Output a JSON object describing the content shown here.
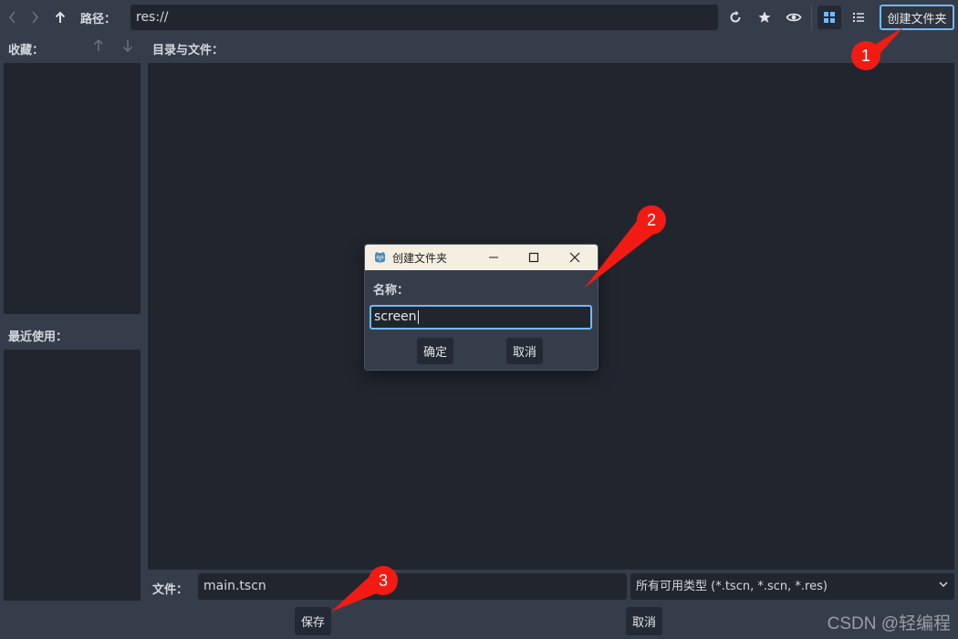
{
  "toolbar": {
    "path_label": "路径：",
    "path_value": "res://",
    "create_folder_label": "创建文件夹"
  },
  "favorites": {
    "label": "收藏："
  },
  "recent": {
    "label": "最近使用："
  },
  "files": {
    "label": "目录与文件："
  },
  "dialog": {
    "title": "创建文件夹",
    "name_label": "名称：",
    "name_value": "screen",
    "confirm_label": "确定",
    "cancel_label": "取消"
  },
  "footer": {
    "file_label": "文件：",
    "file_value": "main.tscn",
    "filter_value": "所有可用类型 (*.tscn, *.scn, *.res)",
    "save_label": "保存",
    "cancel_label": "取消"
  },
  "annotations": [
    "1",
    "2",
    "3"
  ],
  "watermark": "CSDN @轻编程",
  "colors": {
    "background": "#363d4a",
    "panel": "#21262e",
    "accent": "#70bafa",
    "annotation": "#f21b14"
  },
  "icons": [
    "back-icon",
    "forward-icon",
    "up-icon",
    "refresh-icon",
    "star-icon",
    "eye-icon",
    "grid-view-icon",
    "list-view-icon",
    "move-up-icon",
    "move-down-icon",
    "godot-icon",
    "minimize-icon",
    "maximize-icon",
    "close-icon",
    "chevron-down-icon"
  ]
}
